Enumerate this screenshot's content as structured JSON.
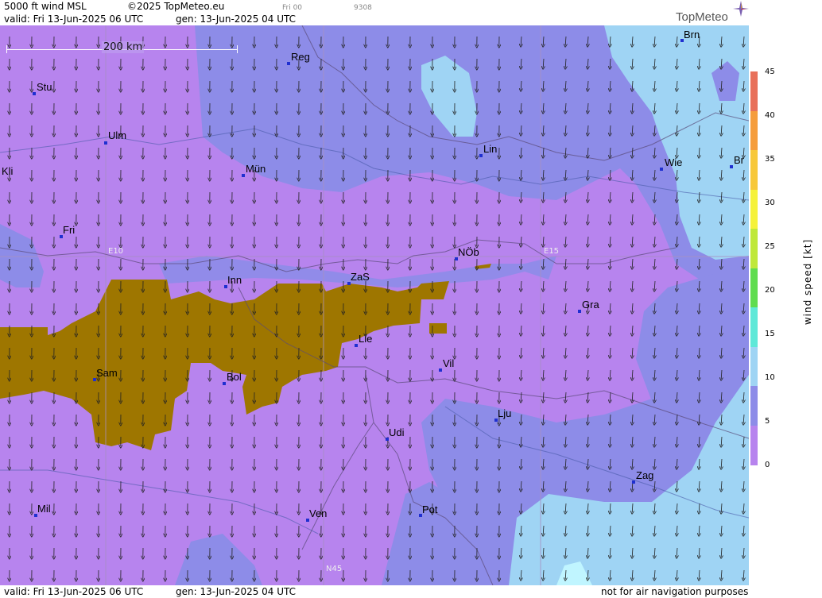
{
  "header": {
    "product": "5000 ft wind MSL",
    "copyright": "©2025 TopMeteo.eu",
    "frame": "Fri 00",
    "code": "9308",
    "valid": "valid:  Fri  13-Jun-2025  06 UTC",
    "gen": "gen: 13-Jun-2025  04 UTC",
    "brand": "TopMeteo"
  },
  "footer": {
    "valid": "valid:  Fri  13-Jun-2025  06 UTC",
    "gen": "gen: 13-Jun-2025  04 UTC",
    "disclaimer": "not for air navigation purposes"
  },
  "scale": {
    "label": "200 km"
  },
  "grid_labels": {
    "e10": "E10",
    "e15": "E15",
    "n45": "N45"
  },
  "cities": [
    {
      "name": "Brn"
    },
    {
      "name": "Reg"
    },
    {
      "name": "Stu"
    },
    {
      "name": "Ulm"
    },
    {
      "name": "Kli"
    },
    {
      "name": "Mün"
    },
    {
      "name": "Lin"
    },
    {
      "name": "Wie"
    },
    {
      "name": "Br"
    },
    {
      "name": "Fri"
    },
    {
      "name": "NÖb"
    },
    {
      "name": "Inn"
    },
    {
      "name": "ZaS"
    },
    {
      "name": "Gra"
    },
    {
      "name": "Lie"
    },
    {
      "name": "Sam"
    },
    {
      "name": "Bol"
    },
    {
      "name": "Vil"
    },
    {
      "name": "Lju"
    },
    {
      "name": "Udi"
    },
    {
      "name": "Zag"
    },
    {
      "name": "Mil"
    },
    {
      "name": "Ven"
    },
    {
      "name": "Pot"
    }
  ],
  "legend": {
    "title": "wind  speed  [kt]",
    "ticks": [
      "45",
      "40",
      "35",
      "30",
      "25",
      "20",
      "15",
      "10",
      "5",
      "0"
    ],
    "colors": [
      "#e8705a",
      "#f59d3c",
      "#f7c83a",
      "#f5f23a",
      "#bfe83a",
      "#5fdc50",
      "#5fe8d8",
      "#9fd4f4",
      "#8d8ce8",
      "#b784ee"
    ]
  },
  "fill_colors": {
    "light": "#b784ee",
    "mid": "#8d8ce8",
    "sky": "#9fd4f4",
    "cyan": "#c0f5ff",
    "terrain": "#9e7600"
  }
}
